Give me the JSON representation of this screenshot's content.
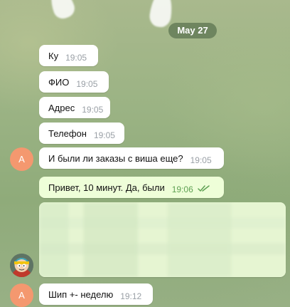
{
  "chat": {
    "date_label": "May 27",
    "messages": [
      {
        "text": "Ку",
        "time": "19:05",
        "direction": "in"
      },
      {
        "text": "ФИО",
        "time": "19:05",
        "direction": "in"
      },
      {
        "text": "Адрес",
        "time": "19:05",
        "direction": "in"
      },
      {
        "text": "Телефон",
        "time": "19:05",
        "direction": "in"
      },
      {
        "text": "И были ли заказы с виша еще?",
        "time": "19:05",
        "direction": "in",
        "sender_initial": "А"
      },
      {
        "text": "Привет, 10 минут. Да, были",
        "time": "19:06",
        "direction": "out",
        "status_icon": "double-check-icon"
      },
      {
        "type": "blurred-media",
        "direction": "in"
      },
      {
        "text": "Шип +- неделю",
        "time": "19:12",
        "direction": "in",
        "sender_initial": "А"
      }
    ]
  },
  "colors": {
    "incoming_bubble": "#ffffff",
    "outgoing_bubble": "#eefed8",
    "avatar_orange": "#f4986f",
    "outgoing_time": "#5fa154",
    "incoming_time": "#9aa0a6"
  }
}
